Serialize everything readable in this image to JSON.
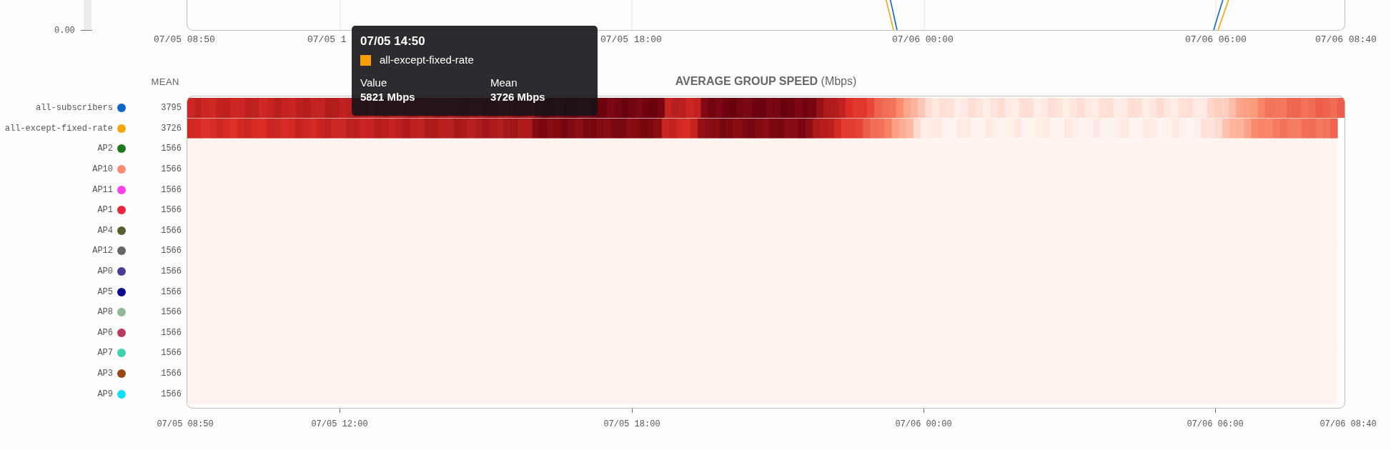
{
  "line_chart": {
    "y_tick": "0.00",
    "x_labels": [
      "07/05 08:50",
      "07/05 1",
      "07/05 18:00",
      "07/06 00:00",
      "07/06 06:00",
      "07/06 08:40"
    ]
  },
  "tooltip": {
    "title": "07/05 14:50",
    "series": "all-except-fixed-rate",
    "color": "#f59f0a",
    "value_label": "Value",
    "value": "5821 Mbps",
    "mean_label": "Mean",
    "mean": "3726 Mbps"
  },
  "heatmap": {
    "mean_heading": "MEAN",
    "title": "**AVERAGE GROUP SPEED** (Mbps)",
    "rows": [
      {
        "name": "all-subscribers",
        "color": "#0a66c8",
        "mean": "3795"
      },
      {
        "name": "all-except-fixed-rate",
        "color": "#f5a30a",
        "mean": "3726"
      },
      {
        "name": "AP2",
        "color": "#1b7a1f",
        "mean": "1566"
      },
      {
        "name": "AP10",
        "color": "#fa8a70",
        "mean": "1566"
      },
      {
        "name": "AP11",
        "color": "#ff40ec",
        "mean": "1566"
      },
      {
        "name": "AP1",
        "color": "#e8283a",
        "mean": "1566"
      },
      {
        "name": "AP4",
        "color": "#55602e",
        "mean": "1566"
      },
      {
        "name": "AP12",
        "color": "#666666",
        "mean": "1566"
      },
      {
        "name": "AP0",
        "color": "#4a3c92",
        "mean": "1566"
      },
      {
        "name": "AP5",
        "color": "#0a0a8e",
        "mean": "1566"
      },
      {
        "name": "AP8",
        "color": "#8fb896",
        "mean": "1566"
      },
      {
        "name": "AP6",
        "color": "#b83c5e",
        "mean": "1566"
      },
      {
        "name": "AP7",
        "color": "#40d0ae",
        "mean": "1566"
      },
      {
        "name": "AP3",
        "color": "#9a4812",
        "mean": "1566"
      },
      {
        "name": "AP9",
        "color": "#10def8",
        "mean": "1566"
      }
    ],
    "x_labels": [
      "07/05 08:50",
      "07/05 12:00",
      "07/05 18:00",
      "07/06 00:00",
      "07/06 06:00",
      "07/06 08:40"
    ]
  }
}
